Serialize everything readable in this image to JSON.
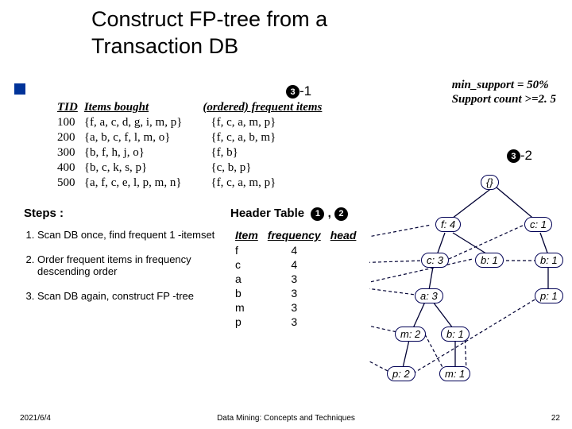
{
  "title_line1": "Construct FP-tree from a",
  "title_line2": "Transaction DB",
  "min_support_line1": "min_support = 50%",
  "min_support_line2": "Support count >=2. 5",
  "marker31_num": "3",
  "marker31_suffix": "-1",
  "marker32_num": "3",
  "marker32_suffix": "-2",
  "header_marker1": "1",
  "header_marker2": "2",
  "tx": {
    "cols": [
      "TID",
      "Items bought",
      "(ordered) frequent items"
    ],
    "rows": [
      {
        "tid": "100",
        "items": "{f, a, c, d, g, i, m, p}",
        "ord": "{f, c, a, m, p}"
      },
      {
        "tid": "200",
        "items": "{a, b, c, f, l, m, o}",
        "ord": "{f, c, a, b, m}"
      },
      {
        "tid": "300",
        "items": "{b, f, h, j, o}",
        "ord": "{f, b}"
      },
      {
        "tid": "400",
        "items": "{b, c, k, s, p}",
        "ord": "{c, b, p}"
      },
      {
        "tid": "500",
        "items": "{a, f, c, e, l, p, m, n}",
        "ord": "{f, c, a, m, p}"
      }
    ]
  },
  "steps_label": "Steps",
  "header_table_label": "Header Table",
  "steps": [
    "Scan DB once, find frequent 1 -itemset",
    "Order frequent items in frequency descending order",
    "Scan DB again, construct FP -tree"
  ],
  "header_table": {
    "cols": [
      "Item",
      "frequency",
      "head"
    ],
    "rows": [
      {
        "item": "f",
        "freq": "4"
      },
      {
        "item": "c",
        "freq": "4"
      },
      {
        "item": "a",
        "freq": "3"
      },
      {
        "item": "b",
        "freq": "3"
      },
      {
        "item": "m",
        "freq": "3"
      },
      {
        "item": "p",
        "freq": "3"
      }
    ]
  },
  "tree": {
    "root": "{}",
    "nodes": {
      "f4": "f: 4",
      "c1": "c: 1",
      "c3": "c: 3",
      "b1a": "b: 1",
      "b1b": "b: 1",
      "a3": "a: 3",
      "p1": "p: 1",
      "m2": "m: 2",
      "b1c": "b: 1",
      "p2": "p: 2",
      "m1": "m: 1"
    }
  },
  "footer": {
    "date": "2021/6/4",
    "center": "Data Mining: Concepts and Techniques",
    "page": "22"
  }
}
